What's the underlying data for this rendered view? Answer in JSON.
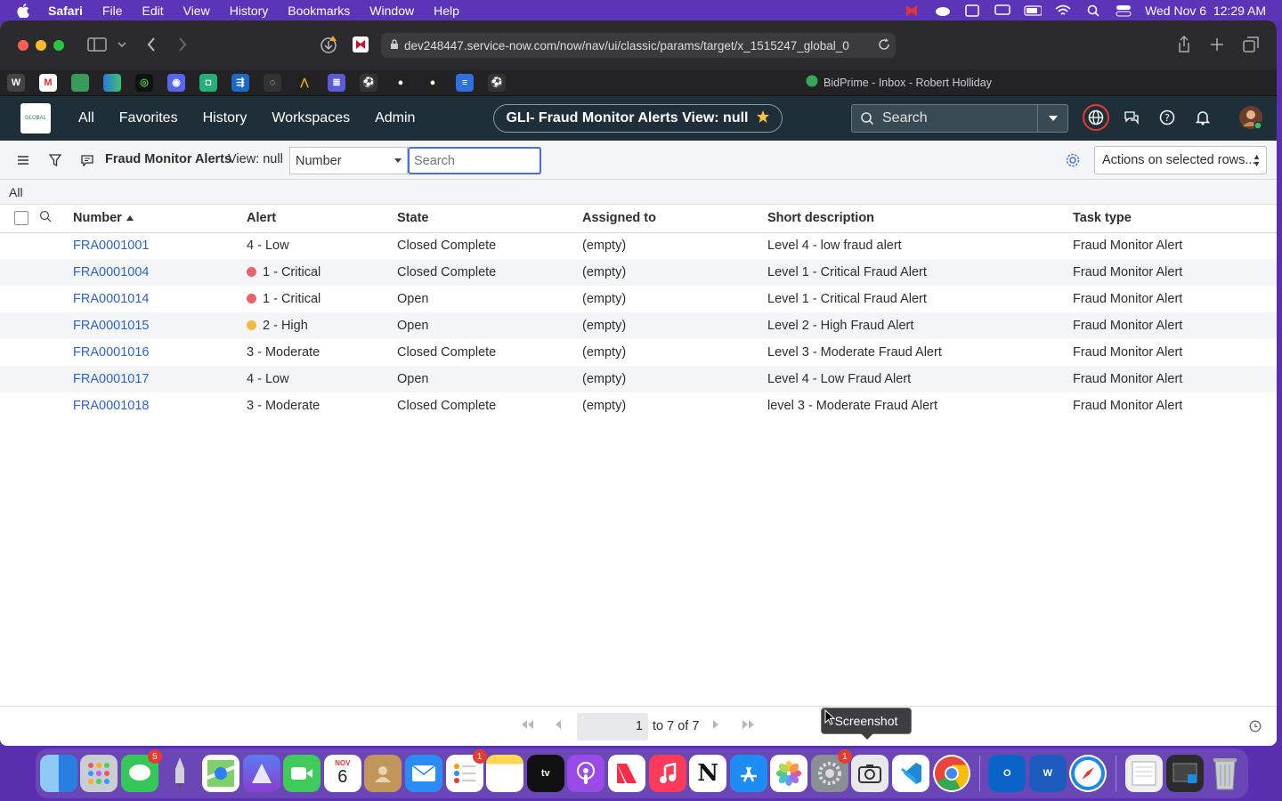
{
  "menubar": {
    "app": "Safari",
    "items": [
      "File",
      "Edit",
      "View",
      "History",
      "Bookmarks",
      "Window",
      "Help"
    ],
    "datetime": "Wed Nov 6  12:29 AM"
  },
  "safari": {
    "url": "dev248447.service-now.com/now/nav/ui/classic/params/target/x_1515247_global_0",
    "tab_title": "BidPrime - Inbox - Robert Holliday"
  },
  "servicenow": {
    "nav": [
      "All",
      "Favorites",
      "History",
      "Workspaces",
      "Admin"
    ],
    "context_title": "GLI- Fraud Monitor Alerts View: null",
    "search_placeholder": "Search"
  },
  "list": {
    "title": "Fraud Monitor Alerts",
    "view": "View: null",
    "field_select": "Number",
    "search_placeholder": "Search",
    "actions_label": "Actions on selected rows...",
    "breadcrumb": "All",
    "columns": [
      "Number",
      "Alert",
      "State",
      "Assigned to",
      "Short description",
      "Task type"
    ],
    "rows": [
      {
        "number": "FRA0001001",
        "alert": "4 - Low",
        "dot": "",
        "state": "Closed Complete",
        "assigned": "(empty)",
        "desc": "Level 4 - low fraud alert",
        "type": "Fraud Monitor Alert"
      },
      {
        "number": "FRA0001004",
        "alert": "1 - Critical",
        "dot": "#e8636b",
        "state": "Closed Complete",
        "assigned": "(empty)",
        "desc": "Level 1 - Critical Fraud Alert",
        "type": "Fraud Monitor Alert"
      },
      {
        "number": "FRA0001014",
        "alert": "1 - Critical",
        "dot": "#e8636b",
        "state": "Open",
        "assigned": "(empty)",
        "desc": "Level 1 - Critical Fraud Alert",
        "type": "Fraud Monitor Alert"
      },
      {
        "number": "FRA0001015",
        "alert": "2 - High",
        "dot": "#f5b942",
        "state": "Open",
        "assigned": "(empty)",
        "desc": "Level 2 - High Fraud Alert",
        "type": "Fraud Monitor Alert"
      },
      {
        "number": "FRA0001016",
        "alert": "3 - Moderate",
        "dot": "",
        "state": "Closed Complete",
        "assigned": "(empty)",
        "desc": "Level 3 - Moderate Fraud Alert",
        "type": "Fraud Monitor Alert"
      },
      {
        "number": "FRA0001017",
        "alert": "4 - Low",
        "dot": "",
        "state": "Open",
        "assigned": "(empty)",
        "desc": "Level 4 - Low Fraud Alert",
        "type": "Fraud Monitor Alert"
      },
      {
        "number": "FRA0001018",
        "alert": "3 - Moderate",
        "dot": "",
        "state": "Closed Complete",
        "assigned": "(empty)",
        "desc": "level 3 - Moderate Fraud Alert",
        "type": "Fraud Monitor Alert"
      }
    ]
  },
  "pager": {
    "page": "1",
    "range_text": "to 7 of 7"
  },
  "tooltip": "Screenshot",
  "dock": {
    "calendar_month": "NOV",
    "calendar_day": "6",
    "badges": {
      "messages": "5",
      "reminders": "1",
      "settings": "1"
    }
  },
  "colors": {
    "link": "#2d63c8",
    "critical": "#e8636b",
    "high": "#f5b942",
    "nav_bg": "#1f2f3a"
  }
}
